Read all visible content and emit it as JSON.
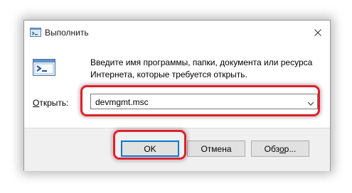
{
  "window": {
    "title": "Выполнить",
    "title_icon": "run-icon",
    "close_icon": "close-icon"
  },
  "dialog": {
    "icon": "run-icon",
    "description_line1": "Введите имя программы, папки, документа или ресурса",
    "description_line2": "Интернета, которые требуется открыть.",
    "open_label_accel": "О",
    "open_label_rest": "ткрыть:",
    "open_value": "devmgmt.msc",
    "dropdown_icon": "chevron-down-icon"
  },
  "buttons": {
    "ok": "OK",
    "cancel": "Отмена",
    "browse_prefix": "Обз",
    "browse_accel": "о",
    "browse_suffix": "р..."
  },
  "colors": {
    "highlight": "#d9232e",
    "default_button_border": "#0078d7",
    "footer_bg": "#f0f0f0"
  }
}
